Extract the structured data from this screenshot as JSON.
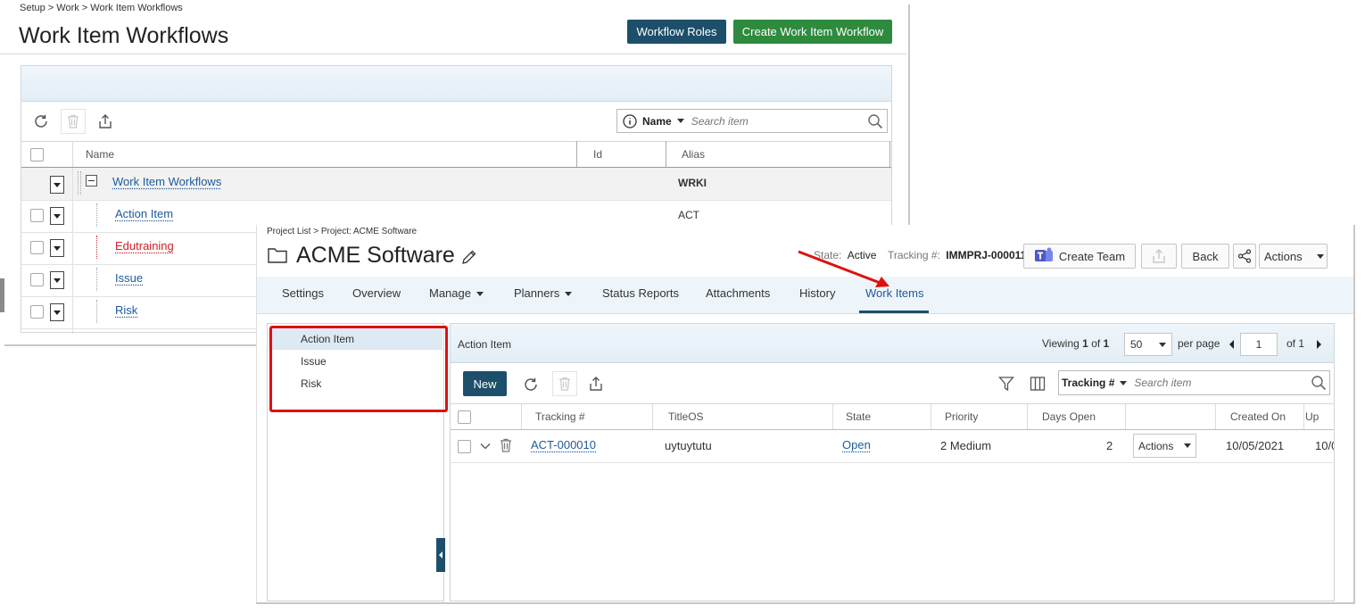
{
  "back_window": {
    "breadcrumb": "Setup > Work > Work Item Workflows",
    "title": "Work Item Workflows",
    "buttons": {
      "workflow_roles": "Workflow Roles",
      "create_workflow": "Create Work Item Workflow"
    },
    "search": {
      "field": "Name",
      "placeholder": "Search item"
    },
    "columns": [
      "Name",
      "Id",
      "Alias"
    ],
    "rows": [
      {
        "name": "Work Item Workflows",
        "alias": "WRKI",
        "color": "#1e5a9a"
      },
      {
        "name": "Action Item",
        "alias": "ACT",
        "color": "#1e5a9a"
      },
      {
        "name": "Edutraining",
        "alias": "",
        "color": "#d0202a"
      },
      {
        "name": "Issue",
        "alias": "",
        "color": "#1e5a9a"
      },
      {
        "name": "Risk",
        "alias": "",
        "color": "#1e5a9a"
      }
    ]
  },
  "front_window": {
    "breadcrumb": "Project List > Project: ACME Software",
    "title": "ACME Software",
    "state_label": "State:",
    "state_value": "Active",
    "tracking_label": "Tracking #:",
    "tracking_value": "IMMPRJ-000011",
    "buttons": {
      "create_team": "Create Team",
      "back": "Back",
      "actions": "Actions"
    },
    "tabs": [
      {
        "label": "Settings",
        "caret": false
      },
      {
        "label": "Overview",
        "caret": false
      },
      {
        "label": "Manage",
        "caret": true
      },
      {
        "label": "Planners",
        "caret": true
      },
      {
        "label": "Status Reports",
        "caret": false
      },
      {
        "label": "Attachments",
        "caret": false
      },
      {
        "label": "History",
        "caret": false
      },
      {
        "label": "Work Items",
        "caret": false,
        "active": true
      }
    ],
    "left_list": [
      "Action Item",
      "Issue",
      "Risk"
    ],
    "grid": {
      "title": "Action Item",
      "viewing_label": "Viewing",
      "viewing_from": "1",
      "viewing_of_label": "of",
      "viewing_total": "1",
      "per_page_value": "50",
      "per_page_label": "per page",
      "page_value": "1",
      "page_of_label": "of 1",
      "new_button": "New",
      "search_field": "Tracking #",
      "search_placeholder": "Search item",
      "columns": [
        "Tracking #",
        "TitleOS",
        "State",
        "Priority",
        "Days Open",
        "",
        "Created On",
        "Up"
      ],
      "rows": [
        {
          "tracking": "ACT-000010",
          "title": "uytuytutu",
          "state": "Open",
          "priority": "2 Medium",
          "days_open": "2",
          "actions": "Actions",
          "created_on": "10/05/2021",
          "updated": "10/0"
        }
      ]
    }
  },
  "colors": {
    "accent_dark": "#1d4f6a",
    "accent_green": "#2e8b3e",
    "annotation_red": "#e01010",
    "link": "#1e5a9a"
  }
}
